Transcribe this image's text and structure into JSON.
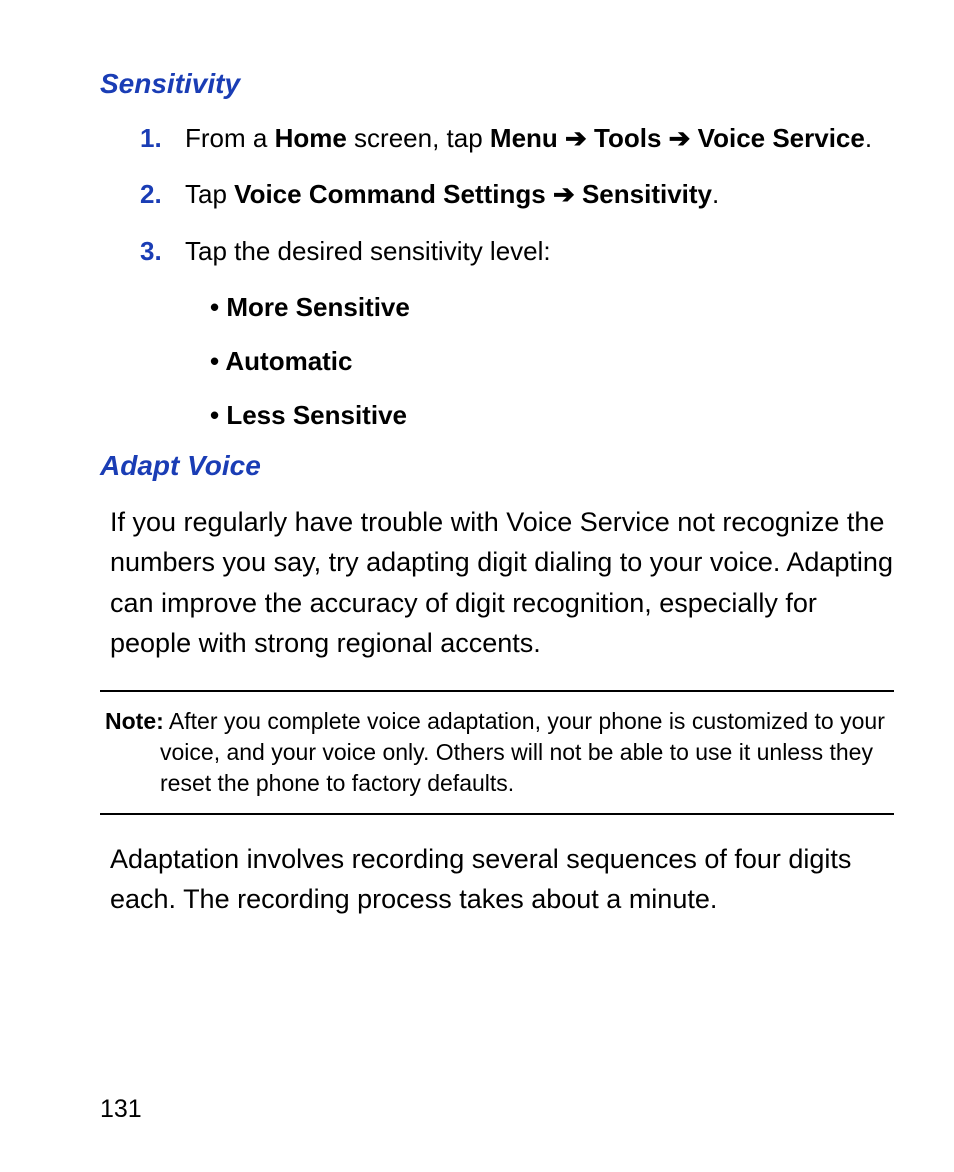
{
  "section1": {
    "heading": "Sensitivity",
    "steps": [
      {
        "num": "1.",
        "pre": "From a ",
        "b1": "Home",
        "mid1": " screen, tap ",
        "b2": "Menu",
        "arr1": " ➔ ",
        "b3": "Tools",
        "arr2": " ➔ ",
        "b4": "Voice Service",
        "end": "."
      },
      {
        "num": "2.",
        "pre": "Tap ",
        "b1": "Voice Command Settings",
        "arr1": " ➔ ",
        "b2": "Sensitivity",
        "end": "."
      },
      {
        "num": "3.",
        "pre": "Tap the desired sensitivity level:"
      }
    ],
    "bullets": [
      "More Sensitive",
      "Automatic",
      "Less Sensitive"
    ]
  },
  "section2": {
    "heading": "Adapt Voice",
    "para1": "If you regularly have trouble with Voice Service not recognize the numbers you say, try adapting digit dialing to your voice. Adapting can improve the accuracy of digit recognition, especially for people with strong regional accents.",
    "note_label": "Note:",
    "note_text": " After you complete voice adaptation, your phone is customized to your voice, and your voice only. Others will not be able to use it unless they reset the phone to factory defaults.",
    "para2": "Adaptation involves recording several sequences of four digits each. The recording process takes about a minute."
  },
  "page_number": "131"
}
